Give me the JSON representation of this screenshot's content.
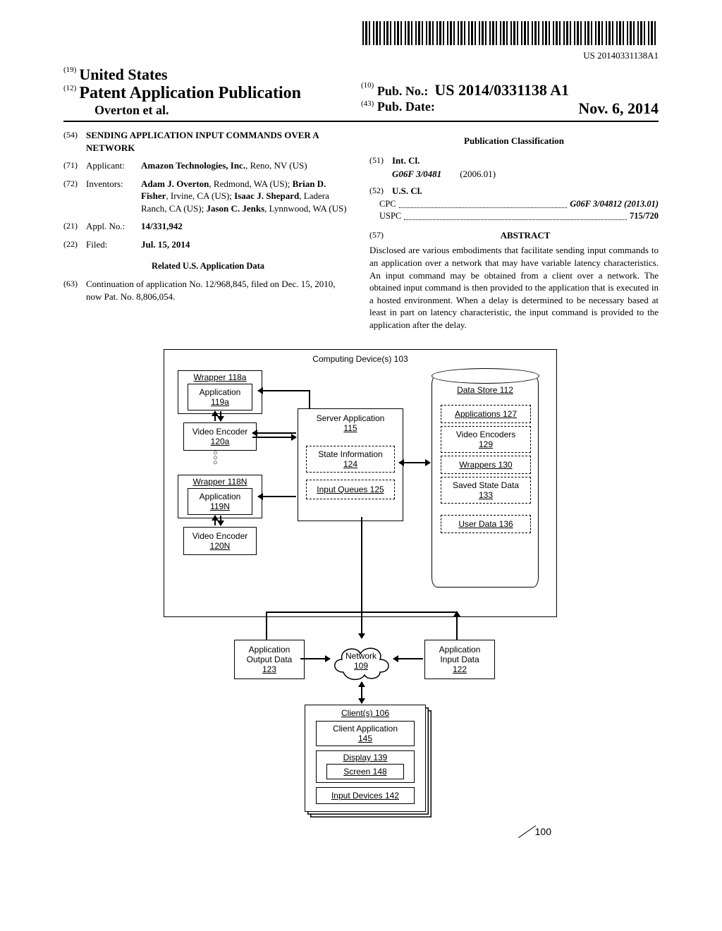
{
  "barcode_text": "US 20140331138A1",
  "header": {
    "num19": "(19)",
    "country": "United States",
    "num12": "(12)",
    "pub_type": "Patent Application Publication",
    "authors_line": "Overton et al.",
    "num10": "(10)",
    "pubno_label": "Pub. No.:",
    "pubno": "US 2014/0331138 A1",
    "num43": "(43)",
    "pubdate_label": "Pub. Date:",
    "pubdate": "Nov. 6, 2014"
  },
  "left": {
    "f54": {
      "n": "(54)",
      "val": "SENDING APPLICATION INPUT COMMANDS OVER A NETWORK"
    },
    "f71": {
      "n": "(71)",
      "lbl": "Applicant:",
      "val_b": "Amazon Technologies, Inc.",
      "val_r": ", Reno, NV (US)"
    },
    "f72": {
      "n": "(72)",
      "lbl": "Inventors:",
      "val": "Adam J. Overton, Redmond, WA (US); Brian D. Fisher, Irvine, CA (US); Isaac J. Shepard, Ladera Ranch, CA (US); Jason C. Jenks, Lynnwood, WA (US)",
      "names": [
        "Adam J. Overton",
        "Brian D. Fisher",
        "Isaac J. Shepard",
        "Jason C. Jenks"
      ]
    },
    "f21": {
      "n": "(21)",
      "lbl": "Appl. No.:",
      "val": "14/331,942"
    },
    "f22": {
      "n": "(22)",
      "lbl": "Filed:",
      "val": "Jul. 15, 2014"
    },
    "related_head": "Related U.S. Application Data",
    "f63": {
      "n": "(63)",
      "val": "Continuation of application No. 12/968,845, filed on Dec. 15, 2010, now Pat. No. 8,806,054."
    }
  },
  "right": {
    "class_head": "Publication Classification",
    "f51": {
      "n": "(51)",
      "lbl": "Int. Cl.",
      "code": "G06F 3/0481",
      "date": "(2006.01)"
    },
    "f52": {
      "n": "(52)",
      "lbl": "U.S. Cl.",
      "cpc_lbl": "CPC",
      "cpc_val": "G06F 3/04812 (2013.01)",
      "uspc_lbl": "USPC",
      "uspc_val": "715/720"
    },
    "f57": {
      "n": "(57)",
      "lbl": "ABSTRACT"
    },
    "abstract": "Disclosed are various embodiments that facilitate sending input commands to an application over a network that may have variable latency characteristics. An input command may be obtained from a client over a network. The obtained input command is then provided to the application that is executed in a hosted environment. When a delay is determined to be necessary based at least in part on latency characteristic, the input command is provided to the application after the delay."
  },
  "diagram": {
    "computing": "Computing Device(s) 103",
    "wrapper_a": "Wrapper 118a",
    "app_a1": "Application",
    "app_a2": "119a",
    "venc_a1": "Video Encoder",
    "venc_a2": "120a",
    "wrapper_n": "Wrapper 118N",
    "app_n1": "Application",
    "app_n2": "119N",
    "venc_n1": "Video Encoder",
    "venc_n2": "120N",
    "srv1": "Server Application",
    "srv2": "115",
    "state1": "State Information",
    "state2": "124",
    "iq": "Input Queues 125",
    "ds": "Data Store 112",
    "apps": "Applications 127",
    "vencs1": "Video Encoders",
    "vencs2": "129",
    "wraps": "Wrappers 130",
    "ssd1": "Saved State Data",
    "ssd2": "133",
    "ud": "User Data 136",
    "aod1": "Application",
    "aod2": "Output Data",
    "aod3": "123",
    "aid1": "Application",
    "aid2": "Input Data",
    "aid3": "122",
    "net1": "Network",
    "net2": "109",
    "clients": "Client(s) 106",
    "capp1": "Client Application",
    "capp2": "145",
    "disp": "Display 139",
    "screen": "Screen 148",
    "idev": "Input Devices 142",
    "fignum": "100"
  }
}
